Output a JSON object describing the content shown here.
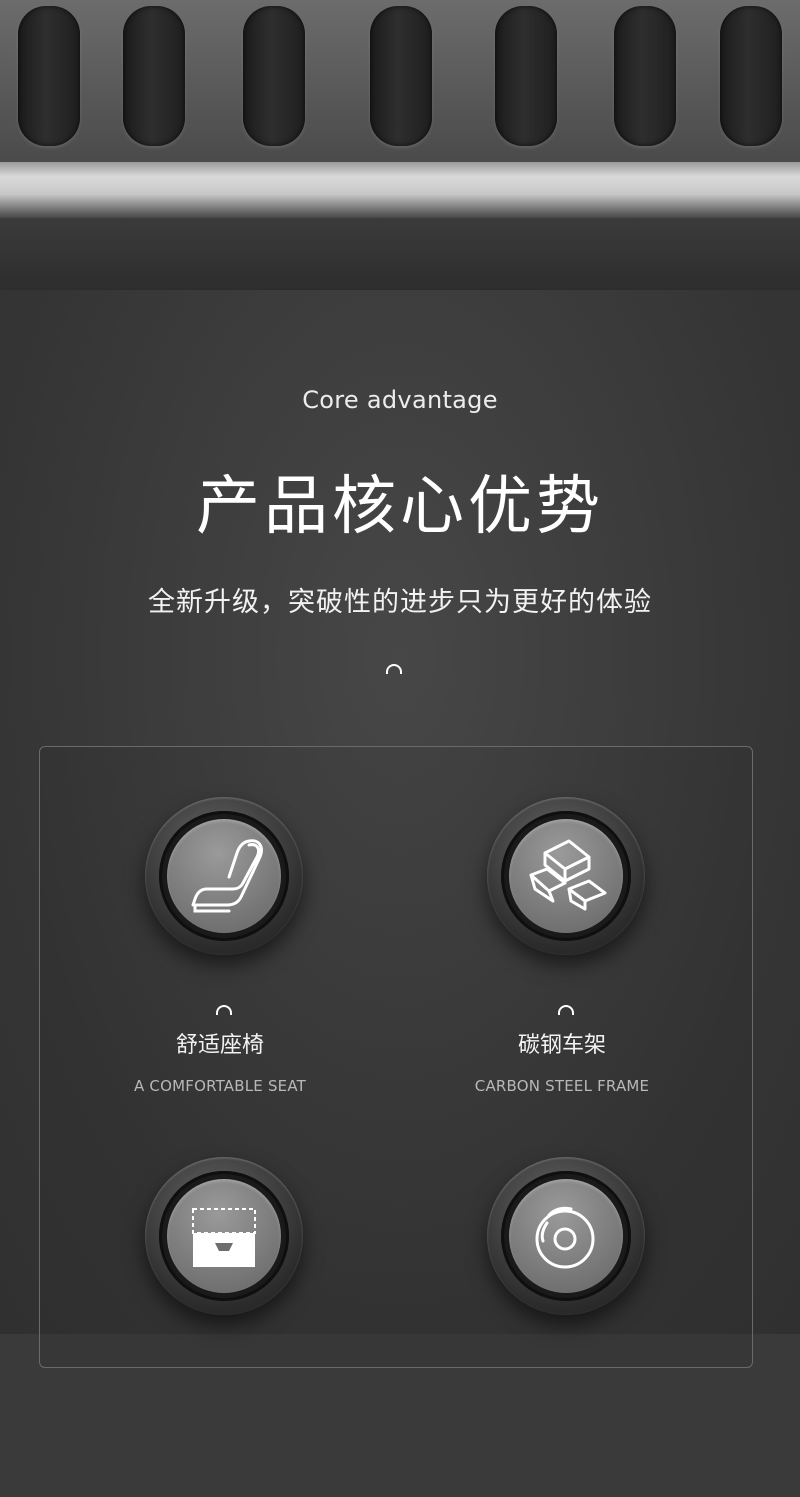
{
  "header": {
    "subtitle_en": "Core advantage",
    "title_cn": "产品核心优势",
    "tagline_cn": "全新升级，突破性的进步只为更好的体验"
  },
  "features": [
    {
      "name": "舒适座椅",
      "subtitle": "A COMFORTABLE SEAT",
      "icon": "seat-icon"
    },
    {
      "name": "碳钢车架",
      "subtitle": "CARBON STEEL FRAME",
      "icon": "steel-bars-icon"
    },
    {
      "name": "",
      "subtitle": "",
      "icon": "storage-box-icon"
    },
    {
      "name": "",
      "subtitle": "",
      "icon": "brake-disc-icon"
    }
  ],
  "colors": {
    "background": "#3a3a3a",
    "text_primary": "#ffffff",
    "text_secondary": "#b8b8b8",
    "panel_border": "#6a6a6a"
  }
}
